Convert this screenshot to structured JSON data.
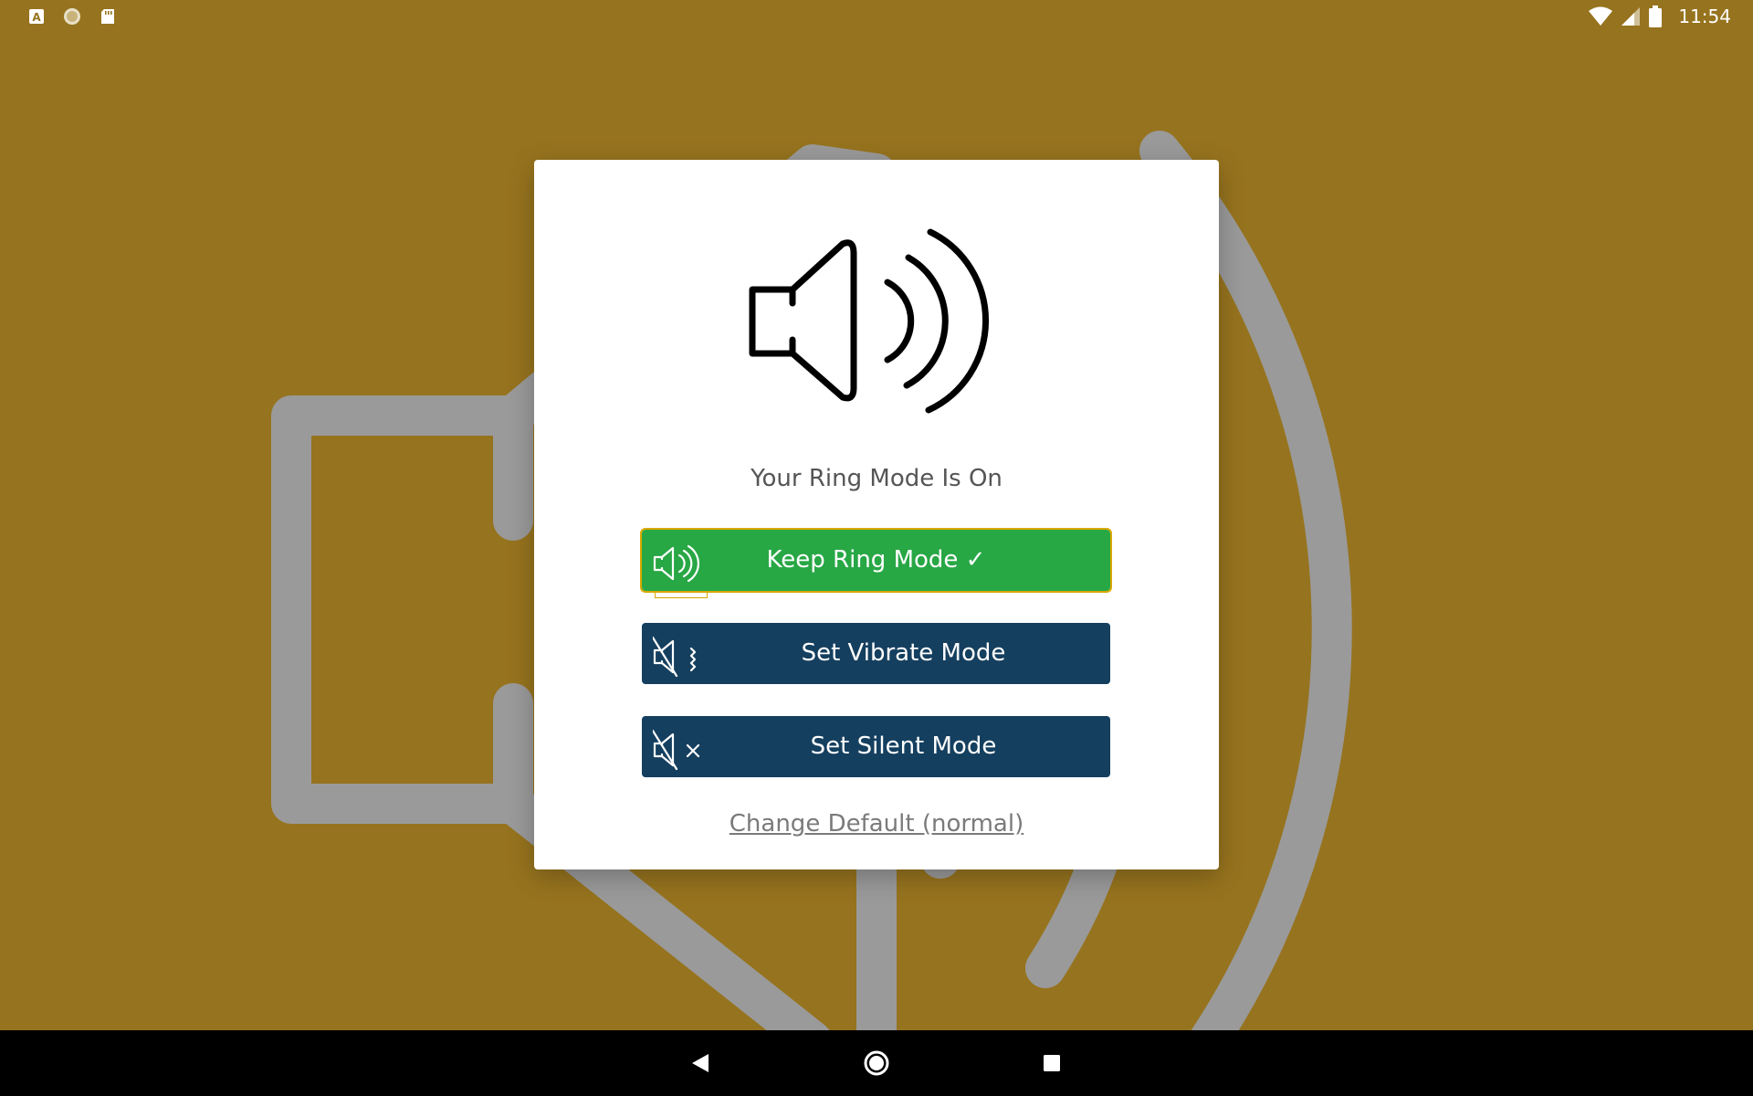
{
  "status_bar": {
    "time": "11:54",
    "notifications": [
      "keyboard-a-icon",
      "circle-app-icon",
      "sd-card-icon"
    ]
  },
  "dialog": {
    "status_message": "Your Ring Mode Is On",
    "buttons": [
      {
        "id": "ring",
        "label": "Keep Ring Mode ✓",
        "color": "#28a745",
        "selected": true
      },
      {
        "id": "vibrate",
        "label": "Set Vibrate Mode",
        "color": "#153f5f",
        "selected": false
      },
      {
        "id": "silent",
        "label": "Set Silent Mode",
        "color": "#153f5f",
        "selected": false
      }
    ],
    "change_default_link": "Change Default (normal)"
  },
  "theme": {
    "wallpaper": "#96731e",
    "wallpaper_icon": "#9a9a9a",
    "ring_green": "#28a745",
    "navy": "#153f5f"
  },
  "nav_bar": {
    "buttons": [
      "back-icon",
      "home-icon",
      "recents-icon"
    ]
  }
}
